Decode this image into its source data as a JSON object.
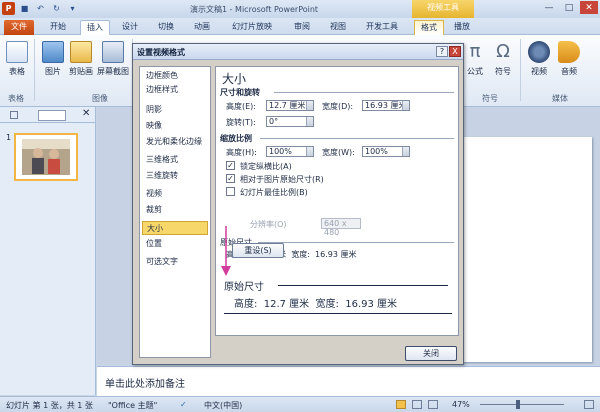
{
  "app": {
    "title": "演示文稿1 - Microsoft PowerPoint",
    "context_group": "视频工具",
    "logo": "P"
  },
  "tabs": [
    "文件",
    "开始",
    "插入",
    "设计",
    "切换",
    "动画",
    "幻灯片放映",
    "审阅",
    "视图",
    "开发工具",
    "格式",
    "播放"
  ],
  "ribbon": {
    "buttons": [
      {
        "label": "表格",
        "icon": "table-icon"
      },
      {
        "label": "图片",
        "icon": "picture-icon"
      },
      {
        "label": "剪贴画",
        "icon": "clipart-icon"
      },
      {
        "label": "屏幕截图",
        "icon": "screenshot-icon"
      },
      {
        "label": "公式",
        "icon": "equation-icon",
        "glyph": "π"
      },
      {
        "label": "符号",
        "icon": "symbol-icon",
        "glyph": "Ω"
      },
      {
        "label": "视频",
        "icon": "video-icon"
      },
      {
        "label": "音频",
        "icon": "audio-icon"
      }
    ],
    "groups": [
      "表格",
      "图像",
      "符号",
      "媒体"
    ]
  },
  "left_pane": {
    "slide_number": "1"
  },
  "notes_placeholder": "单击此处添加备注",
  "status_bar": {
    "slide_info": "幻灯片 第 1 张，共 1 张",
    "theme": "\"Office 主题\"",
    "language": "中文(中国)",
    "zoom": "47%"
  },
  "dialog": {
    "title": "设置视频格式",
    "help": "?",
    "close_x": "X",
    "nav_items": [
      "边框颜色",
      "边框样式",
      "阴影",
      "映像",
      "发光和柔化边缘",
      "三维格式",
      "三维旋转",
      "视频",
      "裁剪",
      "大小",
      "位置",
      "可选文字"
    ],
    "selected_nav": "大小",
    "section_title": "大小",
    "size_rotate": {
      "header": "尺寸和旋转",
      "height_label": "高度(E):",
      "height_value": "12.7 厘米",
      "width_label": "宽度(D):",
      "width_value": "16.93 厘米",
      "rotation_label": "旋转(T):",
      "rotation_value": "0°"
    },
    "scale": {
      "header": "缩放比例",
      "height_label": "高度(H):",
      "height_value": "100%",
      "width_label": "宽度(W):",
      "width_value": "100%",
      "lock_aspect": "锁定纵横比(A)",
      "lock_aspect_checked": true,
      "relative_original": "相对于图片原始尺寸(R)",
      "relative_original_checked": true,
      "best_scale": "幻灯片最佳比例(B)",
      "best_scale_checked": false,
      "resolution_label": "分辨率(O)",
      "resolution_value": "640 x 480"
    },
    "original": {
      "header": "原始尺寸",
      "text": "高度:  12.7 厘米  宽度:  16.93 厘米",
      "reset_label": "重设(S)"
    },
    "zoom_callout": {
      "title": "原始尺寸",
      "text": "高度:  12.7 厘米  宽度:  16.93 厘米"
    },
    "close_label": "关闭"
  },
  "colors": {
    "file_tab": "#c24511",
    "context_tab": "#e6b52f",
    "selected_nav": "#f7d76a",
    "arrow": "#d23c9c"
  }
}
